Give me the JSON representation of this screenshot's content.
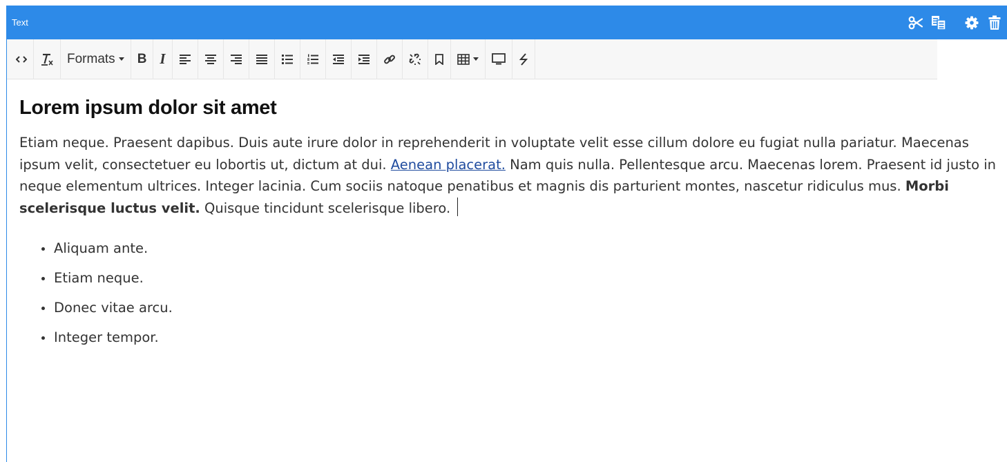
{
  "header": {
    "title": "Text",
    "actions": [
      {
        "name": "cut",
        "icon": "scissors-icon"
      },
      {
        "name": "copy",
        "icon": "copy-icon"
      },
      {
        "name": "settings",
        "icon": "gear-icon"
      },
      {
        "name": "delete",
        "icon": "trash-icon"
      }
    ],
    "color": "#2d8ae8"
  },
  "toolbar": {
    "formats_label": "Formats",
    "bold_label": "B",
    "italic_label": "I",
    "buttons": [
      "source-code-icon",
      "clear-formatting-icon",
      "formats-dropdown",
      "bold-icon",
      "italic-icon",
      "align-left-icon",
      "align-center-icon",
      "align-right-icon",
      "justify-icon",
      "bullet-list-icon",
      "numbered-list-icon",
      "outdent-icon",
      "indent-icon",
      "link-icon",
      "unlink-icon",
      "bookmark-icon",
      "table-icon",
      "preview-icon",
      "special-char-icon"
    ]
  },
  "content": {
    "heading": "Lorem ipsum dolor sit amet",
    "paragraph": {
      "part1": "Etiam neque. Praesent dapibus. Duis aute irure dolor in reprehenderit in voluptate velit esse cillum dolore eu fugiat nulla pariatur. Maecenas ipsum velit, consectetuer eu lobortis ut, dictum at dui. ",
      "link": "Aenean placerat.",
      "part2": " Nam quis nulla. Pellentesque arcu. Maecenas lorem. Praesent id justo in neque elementum ultrices. Integer lacinia. Cum sociis natoque penatibus et magnis dis parturient montes, nascetur ridiculus mus. ",
      "bold": "Morbi scelerisque luctus velit.",
      "part3": " Quisque tincidunt scelerisque libero."
    },
    "list": [
      "Aliquam ante.",
      "Etiam neque.",
      "Donec vitae arcu.",
      "Integer tempor."
    ],
    "link_color": "#1f4b9e"
  }
}
